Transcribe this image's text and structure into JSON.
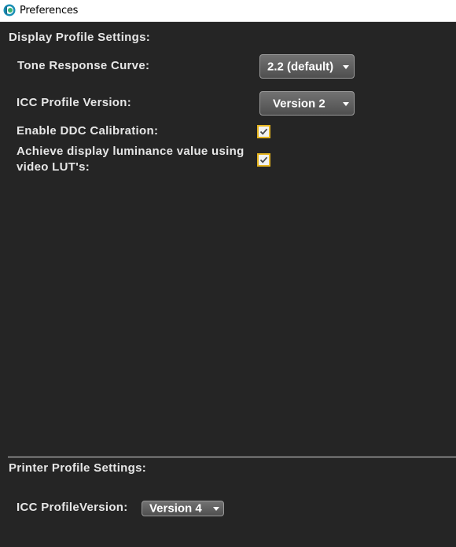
{
  "window": {
    "title": "Preferences",
    "icon": "app-logo-icon"
  },
  "display_profile": {
    "heading": "Display Profile Settings:",
    "tone_response_curve": {
      "label": "Tone Response Curve:",
      "selected": "2.2 (default)"
    },
    "icc_profile_version": {
      "label": "ICC Profile Version:",
      "selected": "Version 2"
    },
    "enable_ddc_calibration": {
      "label": "Enable DDC Calibration:",
      "checked": true
    },
    "achieve_luminance": {
      "label_line1": "Achieve display luminance value using",
      "label_line2": "video LUT's:",
      "checked": true
    }
  },
  "printer_profile": {
    "heading": "Printer Profile Settings:",
    "icc_profile_version": {
      "label": "ICC ProfileVersion:",
      "selected": "Version 4"
    }
  },
  "colors": {
    "background": "#252525",
    "text": "#e6e6e6",
    "checkbox_border": "#e5b41f"
  }
}
